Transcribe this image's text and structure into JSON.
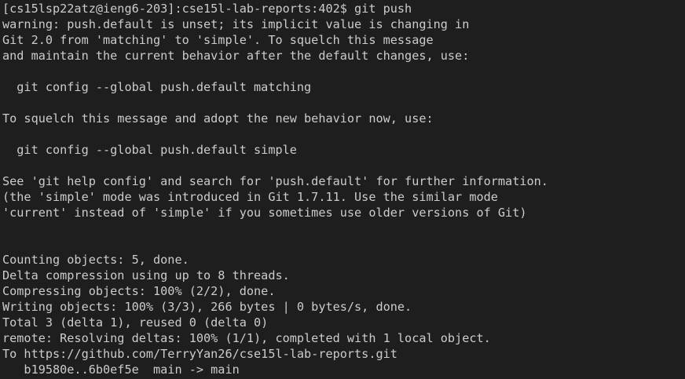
{
  "terminal": {
    "background": "#1e1e1e",
    "foreground": "#cccccc",
    "lines": [
      "[cs15lsp22atz@ieng6-203]:cse15l-lab-reports:402$ git push",
      "warning: push.default is unset; its implicit value is changing in",
      "Git 2.0 from 'matching' to 'simple'. To squelch this message",
      "and maintain the current behavior after the default changes, use:",
      "",
      "  git config --global push.default matching",
      "",
      "To squelch this message and adopt the new behavior now, use:",
      "",
      "  git config --global push.default simple",
      "",
      "See 'git help config' and search for 'push.default' for further information.",
      "(the 'simple' mode was introduced in Git 1.7.11. Use the similar mode",
      "'current' instead of 'simple' if you sometimes use older versions of Git)",
      "",
      "",
      "Counting objects: 5, done.",
      "Delta compression using up to 8 threads.",
      "Compressing objects: 100% (2/2), done.",
      "Writing objects: 100% (3/3), 266 bytes | 0 bytes/s, done.",
      "Total 3 (delta 1), reused 0 (delta 0)",
      "remote: Resolving deltas: 100% (1/1), completed with 1 local object.",
      "To https://github.com/TerryYan26/cse15l-lab-reports.git",
      "   b19580e..6b0ef5e  main -> main"
    ]
  }
}
